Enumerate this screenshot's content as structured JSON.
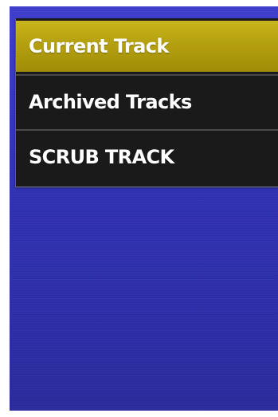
{
  "menu": {
    "items": [
      {
        "label": "Current Track",
        "selected": true
      },
      {
        "label": "Archived Tracks",
        "selected": false
      },
      {
        "label": "SCRUB TRACK",
        "selected": false
      }
    ]
  },
  "colors": {
    "background_blue": "#3232b8",
    "selected_gold": "#b4a00f",
    "menu_dark": "#1a1a1a",
    "text": "#ffffff"
  }
}
